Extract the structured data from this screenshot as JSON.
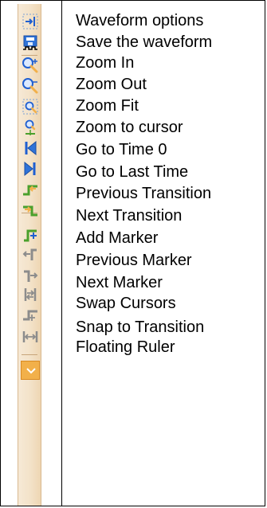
{
  "toolbar": {
    "buttons": [
      {
        "icon": "waveform-options-icon",
        "label": "Waveform options"
      },
      {
        "icon": "save-waveform-icon",
        "label": "Save the waveform"
      },
      {
        "icon": "zoom-in-icon",
        "label": "Zoom In"
      },
      {
        "icon": "zoom-out-icon",
        "label": "Zoom Out"
      },
      {
        "icon": "zoom-fit-icon",
        "label": "Zoom Fit"
      },
      {
        "icon": "zoom-to-cursor-icon",
        "label": "Zoom to cursor"
      },
      {
        "icon": "go-to-time-0-icon",
        "label": "Go to Time 0"
      },
      {
        "icon": "go-to-last-time-icon",
        "label": "Go to Last Time"
      },
      {
        "icon": "previous-transition-icon",
        "label": "Previous Transition"
      },
      {
        "icon": "next-transition-icon",
        "label": "Next Transition"
      },
      {
        "icon": "add-marker-icon",
        "label": "Add Marker"
      },
      {
        "icon": "previous-marker-icon",
        "label": "Previous Marker"
      },
      {
        "icon": "next-marker-icon",
        "label": "Next Marker"
      },
      {
        "icon": "swap-cursors-icon",
        "label": "Swap Cursors"
      },
      {
        "icon": "snap-to-transition-icon",
        "label": "Snap to Transition"
      },
      {
        "icon": "floating-ruler-icon",
        "label": "Floating Ruler"
      }
    ]
  },
  "colors": {
    "accent_blue": "#1f5fd1",
    "accent_green": "#4aa02c",
    "accent_yellow": "#f2b04a",
    "disabled_gray": "#8c8c8c"
  }
}
